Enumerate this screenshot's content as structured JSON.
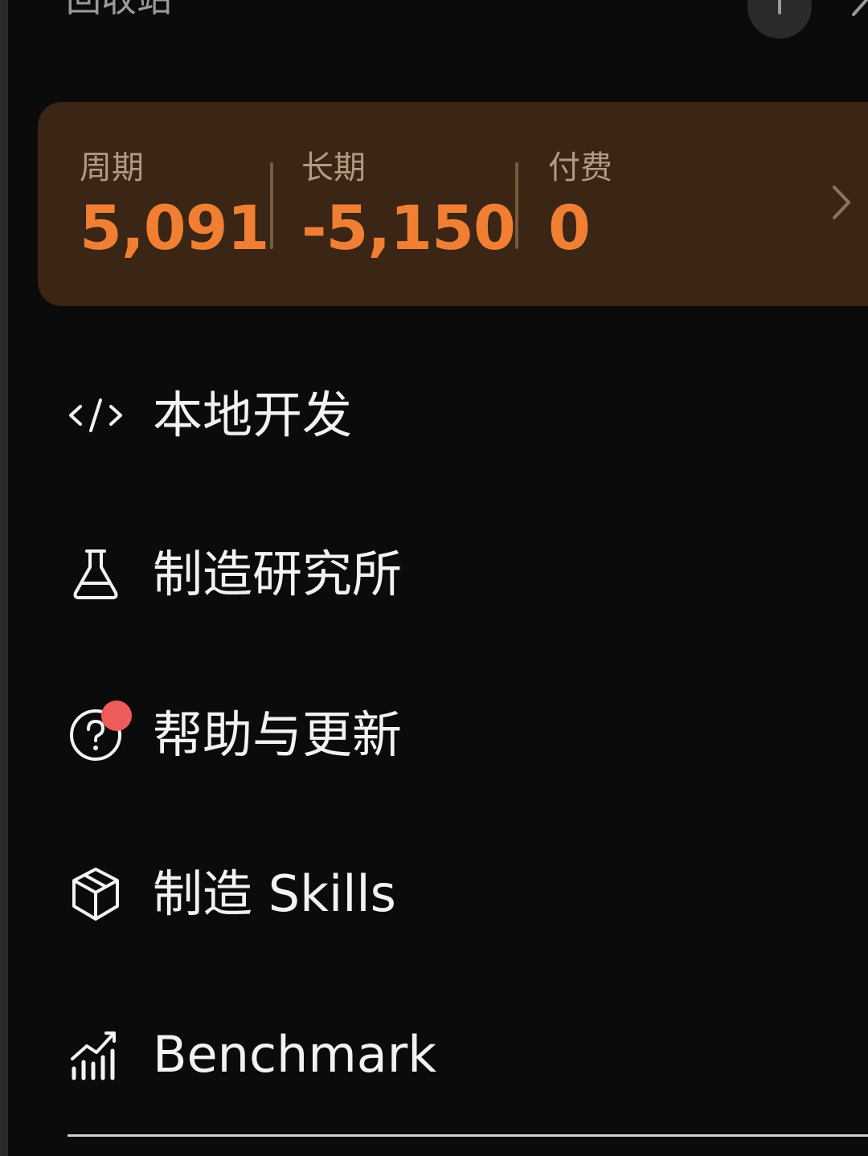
{
  "header": {
    "title": "回收站"
  },
  "quota": {
    "stats": [
      {
        "label": "周期",
        "value": "5,091"
      },
      {
        "label": "长期",
        "value": "-5,150"
      },
      {
        "label": "付费",
        "value": "0"
      }
    ],
    "accent_color": "#f07f33"
  },
  "menu": {
    "items": [
      {
        "label": "本地开发",
        "icon": "code-icon"
      },
      {
        "label": "制造研究所",
        "icon": "flask-icon"
      },
      {
        "label": "帮助与更新",
        "icon": "help-icon",
        "has_notification": true
      },
      {
        "label": "制造 Skills",
        "icon": "cube-icon"
      },
      {
        "label": "Benchmark",
        "icon": "chart-icon"
      }
    ]
  }
}
